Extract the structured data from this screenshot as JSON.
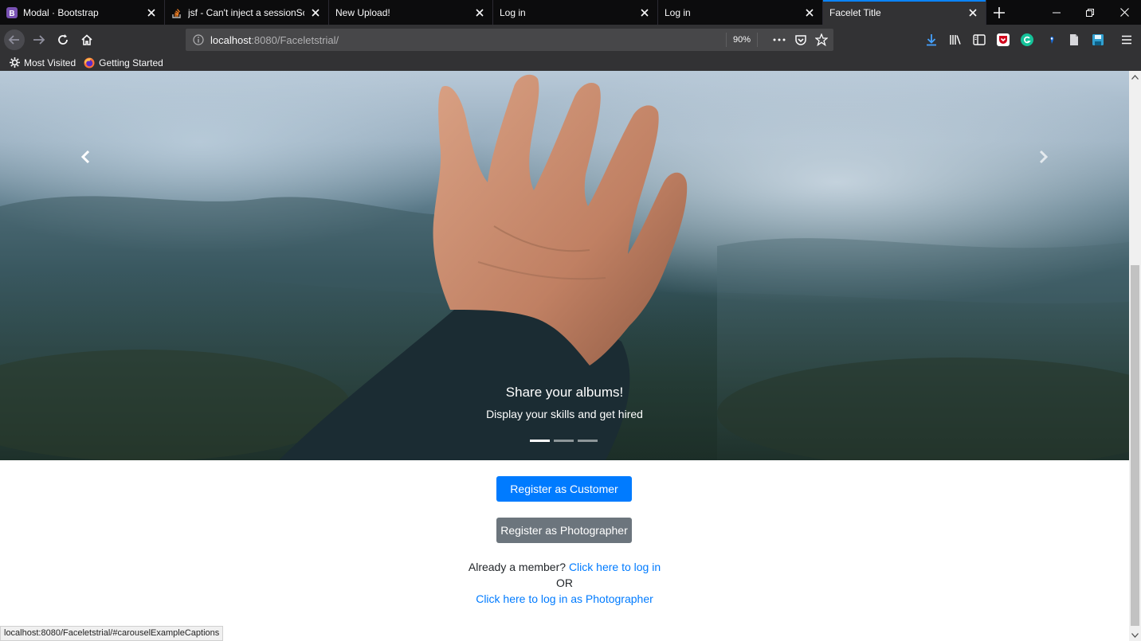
{
  "browser": {
    "tabs": [
      {
        "title": "Modal · Bootstrap",
        "favicon": "bootstrap-icon",
        "favicon_letter": "B",
        "active": false
      },
      {
        "title": "jsf - Can't inject a sessionScope",
        "favicon": "stackoverflow-icon",
        "active": false
      },
      {
        "title": "New Upload!",
        "favicon": "",
        "active": false
      },
      {
        "title": "Log in",
        "favicon": "",
        "active": false
      },
      {
        "title": "Log in",
        "favicon": "",
        "active": false
      },
      {
        "title": "Facelet Title",
        "favicon": "",
        "active": true
      }
    ],
    "url_host": "localhost",
    "url_rest": ":8080/Faceletstrial/",
    "zoom": "90%",
    "accent_color": "#0a84ff"
  },
  "bookmarks": {
    "items": [
      {
        "label": "Most Visited",
        "icon": "gear-icon"
      },
      {
        "label": "Getting Started",
        "icon": "firefox-icon"
      }
    ]
  },
  "carousel": {
    "title": "Share your albums!",
    "subtitle": "Display your skills and get hired",
    "slide_count": 3,
    "active_index": 0
  },
  "actions": {
    "register_customer": "Register as Customer",
    "register_photographer": "Register as Photographer",
    "primary_color": "#007bff",
    "secondary_color": "#6c757d"
  },
  "login": {
    "prompt": "Already a member?",
    "link": "Click here to log in",
    "or": "OR",
    "photographer_link": "Click here to log in as Photographer"
  },
  "status": {
    "url": "localhost:8080/Faceletstrial/#carouselExampleCaptions"
  }
}
